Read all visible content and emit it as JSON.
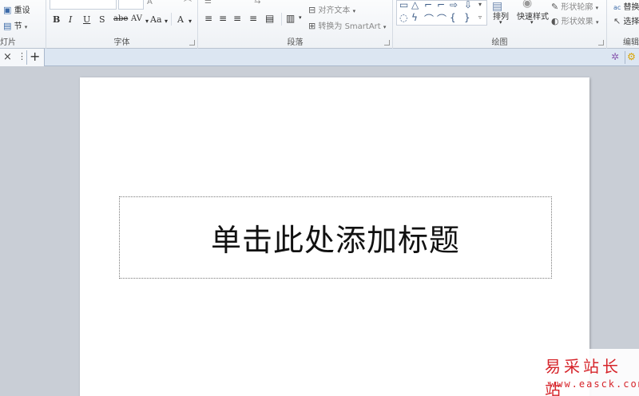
{
  "ribbon": {
    "slides_group": {
      "label": "幻灯片",
      "label_visible": "灯片",
      "reset": "重设",
      "section": "节"
    },
    "font_group": {
      "label": "字体",
      "bold": "B",
      "italic": "I",
      "underline": "U",
      "shadow": "S",
      "strike": "abe",
      "spacing": "AV",
      "case": "Aa",
      "color": "A"
    },
    "paragraph_group": {
      "label": "段落",
      "align_text": "对齐文本",
      "convert_smartart": "转换为 SmartArt"
    },
    "drawing_group": {
      "label": "绘图",
      "arrange": "排列",
      "quick_styles": "快速样式",
      "shape_outline": "形状轮廓",
      "shape_effects": "形状效果"
    },
    "editing_group": {
      "label": "编辑",
      "replace": "替换",
      "select": "选择"
    }
  },
  "tabs": {
    "close": "×",
    "more": "⋮",
    "add": "+"
  },
  "slide": {
    "title_placeholder": "单击此处添加标题"
  },
  "watermark": {
    "cn": "易采站长站",
    "url": "www.easck.com"
  },
  "colors": {
    "accent_red": "#d6242a",
    "tabbar": "#dce6f2",
    "workspace": "#c9ced6"
  }
}
